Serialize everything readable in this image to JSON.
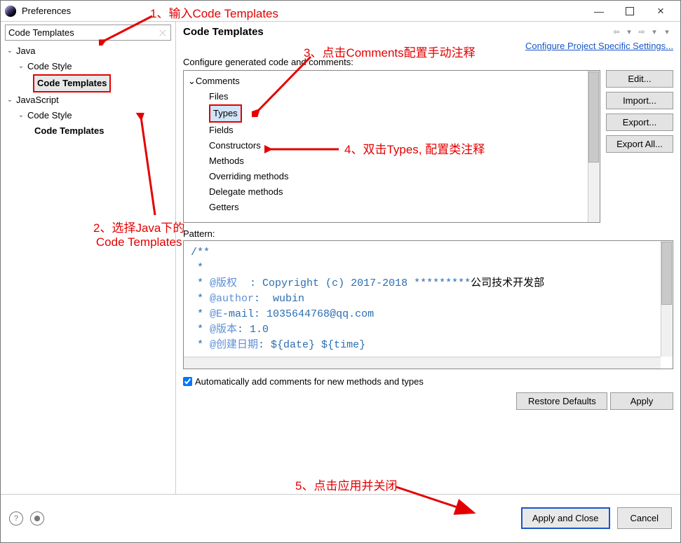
{
  "window": {
    "title": "Preferences"
  },
  "search": {
    "value": "Code Templates"
  },
  "sidebar": {
    "java": "Java",
    "java_codestyle": "Code Style",
    "java_codetemplates": "Code Templates",
    "js": "JavaScript",
    "js_codestyle": "Code Style",
    "js_codetemplates": "Code Templates"
  },
  "content": {
    "heading": "Code Templates",
    "configure_link": "Configure Project Specific Settings...",
    "cfg_label": "Configure generated code and comments:",
    "tree": {
      "comments": "Comments",
      "files": "Files",
      "types": "Types",
      "fields": "Fields",
      "constructors": "Constructors",
      "methods": "Methods",
      "overriding": "Overriding methods",
      "delegate": "Delegate methods",
      "getters": "Getters"
    },
    "buttons": {
      "edit": "Edit...",
      "import": "Import...",
      "export": "Export...",
      "export_all": "Export All..."
    },
    "pattern_label": "Pattern:",
    "pattern": {
      "l1": "/**",
      "l2": " *",
      "l3a": " * ",
      "l3b": "@版权",
      "l3c": "  : ",
      "l3d": "Copyright (c) 2017-2018 *********",
      "l3e": "公司技术开发部",
      "l4a": " * ",
      "l4b": "@author",
      "l4c": ":  ",
      "l4d": "wubin",
      "l5a": " * ",
      "l5b": "@E",
      "l5c": "-mail: ",
      "l5d": "1035644768@qq.com",
      "l6a": " * ",
      "l6b": "@版本",
      "l6c": ": ",
      "l6d": "1.0",
      "l7a": " * ",
      "l7b": "@创建日期",
      "l7c": ": ",
      "l7d": "${date} ${time}"
    },
    "auto_chk": "Automatically add comments for new methods and types",
    "restore": "Restore Defaults",
    "apply": "Apply"
  },
  "footer": {
    "apply_close": "Apply and Close",
    "cancel": "Cancel"
  },
  "annotations": {
    "a1": "1、输入Code Templates",
    "a2": "2、选择Java下的\nCode Templates",
    "a3": "3、点击Comments配置手动注释",
    "a4": "4、双击Types, 配置类注释",
    "a5": "5、点击应用并关闭"
  }
}
